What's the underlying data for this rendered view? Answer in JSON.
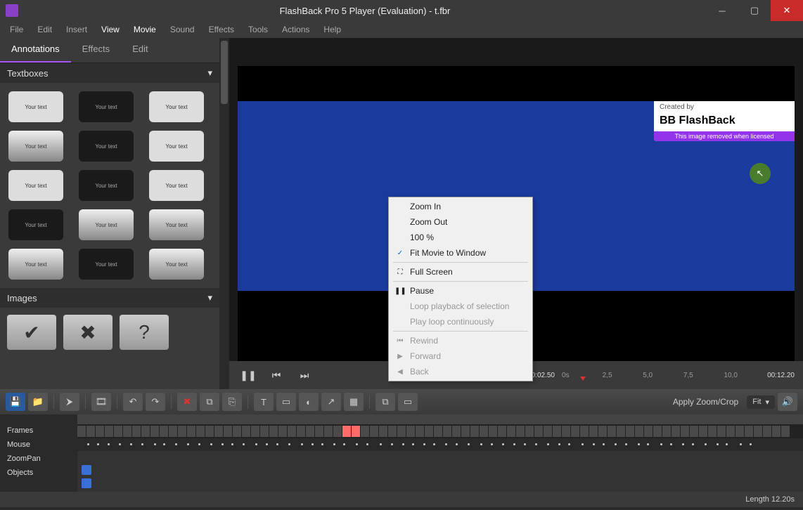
{
  "title": "FlashBack Pro 5 Player (Evaluation) -              t.fbr",
  "menubar": [
    "File",
    "Edit",
    "Insert",
    "View",
    "Movie",
    "Sound",
    "Effects",
    "Tools",
    "Actions",
    "Help"
  ],
  "menubar_active": [
    "View",
    "Movie"
  ],
  "side_tabs": [
    "Annotations",
    "Effects",
    "Edit"
  ],
  "side_active": "Annotations",
  "accordion": {
    "textboxes": "Textboxes",
    "images": "Images"
  },
  "textbox_label": "Your text",
  "overlay": {
    "created_by": "Created by",
    "brand": "BB FlashBack",
    "license_note": "This image removed when licensed"
  },
  "playback": {
    "time_current": "00:02.50",
    "time_total": "00:12.20",
    "ticks": [
      "0s",
      "2,5",
      "5,0",
      "7,5",
      "10,0"
    ]
  },
  "toolbar": {
    "apply_zoom": "Apply Zoom/Crop",
    "fit": "Fit"
  },
  "timeline_tracks": [
    "Frames",
    "Mouse",
    "ZoomPan",
    "Objects"
  ],
  "status": {
    "length": "Length 12.20s"
  },
  "context_menu": [
    {
      "label": "Zoom In",
      "icon": "",
      "disabled": false
    },
    {
      "label": "Zoom Out",
      "icon": "",
      "disabled": false
    },
    {
      "label": "100 %",
      "icon": "",
      "disabled": false
    },
    {
      "label": "Fit Movie to Window",
      "icon": "✓",
      "checked": true,
      "disabled": false
    },
    {
      "sep": true
    },
    {
      "label": "Full Screen",
      "icon": "⛶",
      "disabled": false
    },
    {
      "sep": true
    },
    {
      "label": "Pause",
      "icon": "❚❚",
      "disabled": false
    },
    {
      "label": "Loop playback of selection",
      "icon": "",
      "disabled": true
    },
    {
      "label": "Play loop continuously",
      "icon": "",
      "disabled": true
    },
    {
      "sep": true
    },
    {
      "label": "Rewind",
      "icon": "⏮",
      "disabled": true
    },
    {
      "label": "Forward",
      "icon": "▶",
      "disabled": true
    },
    {
      "label": "Back",
      "icon": "◀",
      "disabled": true
    }
  ]
}
